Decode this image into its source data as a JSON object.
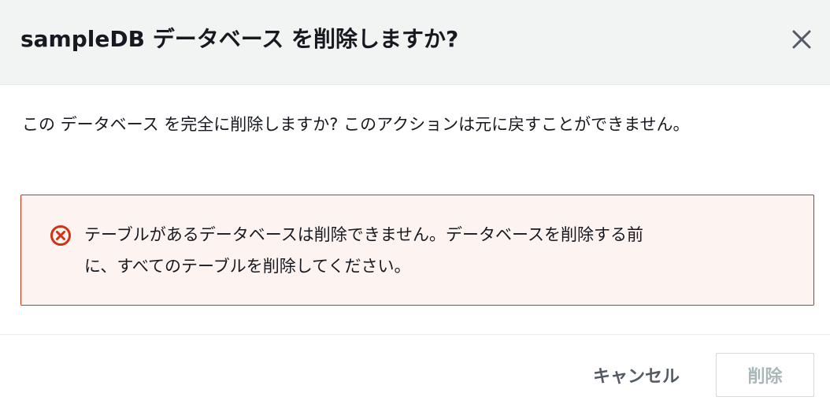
{
  "dialog": {
    "title": "sampleDB データベース を削除しますか?",
    "close_icon": "close-icon",
    "message": "この データベース を完全に削除しますか? このアクションは元に戻すことができません。"
  },
  "alert": {
    "type": "error",
    "icon": "error-circle-x-icon",
    "color": "#d13212",
    "background": "#fdf3f1",
    "line1": "テーブルがあるデータベースは削除できません。データベースを削除する前",
    "line2": "に、すべてのテーブルを削除してください。"
  },
  "footer": {
    "cancel_label": "キャンセル",
    "delete_label": "削除",
    "delete_disabled": true
  }
}
